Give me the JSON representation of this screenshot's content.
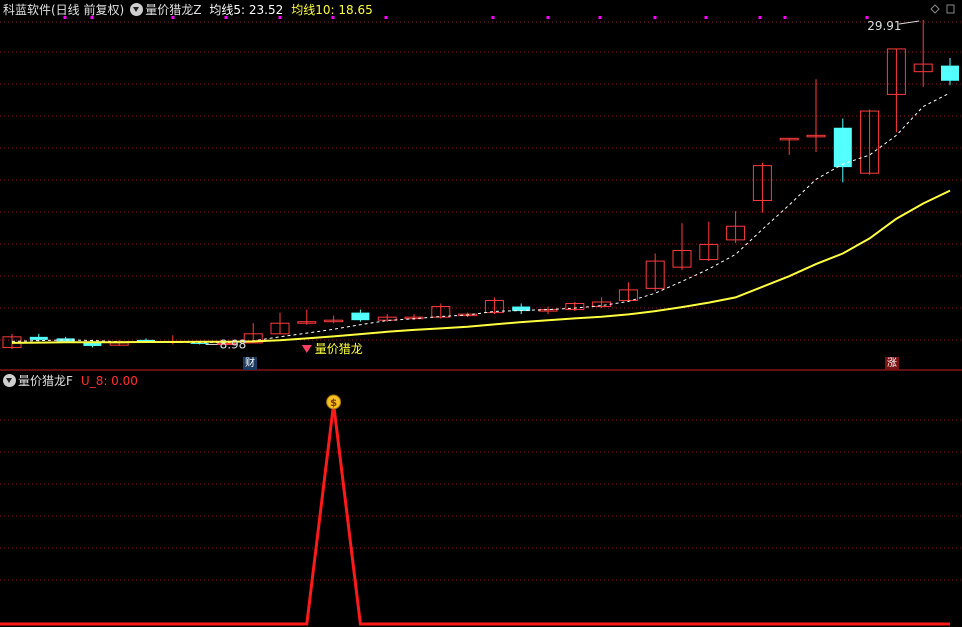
{
  "header": {
    "title": "科蓝软件(日线 前复权)",
    "indicator": "量价猎龙Z",
    "ma5_label": "均线5: 23.52",
    "ma10_label": "均线10: 18.65"
  },
  "sub_header": {
    "indicator": "量价猎龙F",
    "value_label": "U_8: 0.00"
  },
  "annotations": {
    "high": "29.91",
    "low": "8.98",
    "signal": "量价猎龙",
    "badge_cai": "财",
    "badge_zhang": "涨",
    "coin": "$"
  },
  "colors": {
    "up": "#ff3b3b",
    "down": "#54ffff",
    "ma5": "#ffffff",
    "ma10": "#ffff40",
    "grid": "#8b1a1a",
    "indicator": "#ff1a1a",
    "marker": "#ff00ff"
  },
  "chart_data": {
    "type": "candlestick",
    "series": [
      {
        "name": "K",
        "ohlc": [
          [
            8.3,
            9.0,
            9.2,
            8.2
          ],
          [
            9.0,
            8.8,
            9.2,
            8.7
          ],
          [
            8.9,
            8.7,
            9.0,
            8.6
          ],
          [
            8.7,
            8.4,
            8.8,
            8.3
          ],
          [
            8.45,
            8.6,
            8.8,
            8.4
          ],
          [
            8.8,
            8.7,
            8.9,
            8.6
          ],
          [
            8.7,
            8.7,
            9.1,
            8.5
          ],
          [
            8.6,
            8.55,
            8.7,
            8.5
          ],
          [
            8.55,
            8.56,
            8.6,
            8.5
          ],
          [
            8.6,
            9.2,
            9.9,
            8.6
          ],
          [
            9.2,
            9.9,
            10.6,
            9.2
          ],
          [
            9.9,
            10.0,
            10.8,
            9.8
          ],
          [
            10.0,
            10.1,
            10.4,
            9.9
          ],
          [
            10.6,
            10.1,
            10.8,
            10.0
          ],
          [
            10.1,
            10.3,
            10.5,
            10.0
          ],
          [
            10.2,
            10.3,
            10.5,
            10.1
          ],
          [
            10.3,
            11.0,
            11.2,
            10.2
          ],
          [
            10.4,
            10.5,
            10.6,
            10.3
          ],
          [
            10.6,
            11.4,
            11.6,
            10.5
          ],
          [
            11.0,
            10.7,
            11.2,
            10.5
          ],
          [
            10.7,
            10.8,
            11.0,
            10.5
          ],
          [
            10.8,
            11.2,
            11.3,
            10.7
          ],
          [
            11.0,
            11.3,
            11.6,
            10.9
          ],
          [
            11.4,
            12.1,
            12.6,
            11.3
          ],
          [
            12.2,
            14.0,
            14.5,
            12.0
          ],
          [
            13.6,
            14.7,
            16.5,
            13.4
          ],
          [
            14.1,
            15.1,
            16.6,
            14.0
          ],
          [
            15.4,
            16.3,
            17.3,
            15.2
          ],
          [
            18.0,
            20.3,
            20.5,
            17.2
          ],
          [
            22.0,
            22.1,
            22.1,
            21.0
          ],
          [
            22.2,
            22.3,
            26.0,
            21.2
          ],
          [
            22.8,
            20.2,
            23.4,
            19.2
          ],
          [
            19.8,
            23.9,
            24.0,
            19.7
          ],
          [
            25.0,
            28.0,
            28.0,
            22.5
          ],
          [
            26.5,
            27.0,
            29.91,
            25.5
          ],
          [
            26.9,
            25.9,
            27.4,
            25.6
          ]
        ]
      },
      {
        "name": "均线5",
        "values": [
          8.7,
          8.75,
          8.8,
          8.76,
          8.68,
          8.64,
          8.64,
          8.63,
          8.62,
          8.74,
          9.0,
          9.25,
          9.5,
          9.8,
          10.08,
          10.2,
          10.34,
          10.44,
          10.68,
          10.74,
          10.8,
          10.9,
          11.06,
          11.34,
          11.88,
          12.66,
          13.48,
          14.44,
          16.1,
          17.7,
          19.4,
          20.4,
          21.0,
          22.3,
          24.2,
          25.1
        ]
      },
      {
        "name": "均线10",
        "values": [
          8.6,
          8.62,
          8.64,
          8.65,
          8.65,
          8.66,
          8.66,
          8.67,
          8.68,
          8.7,
          8.78,
          8.9,
          9.03,
          9.18,
          9.33,
          9.46,
          9.56,
          9.66,
          9.82,
          9.97,
          10.09,
          10.22,
          10.33,
          10.48,
          10.7,
          10.96,
          11.26,
          11.6,
          12.3,
          13.0,
          13.8,
          14.5,
          15.5,
          16.8,
          17.8,
          18.65
        ]
      },
      {
        "name": "U_8",
        "values": [
          0,
          0,
          0,
          0,
          0,
          0,
          0,
          0,
          0,
          0,
          0,
          0,
          1,
          0,
          0,
          0,
          0,
          0,
          0,
          0,
          0,
          0,
          0,
          0,
          0,
          0,
          0,
          0,
          0,
          0,
          0,
          0,
          0,
          0,
          0,
          0
        ]
      }
    ],
    "high_label": "29.91",
    "low_label": "8.98"
  }
}
